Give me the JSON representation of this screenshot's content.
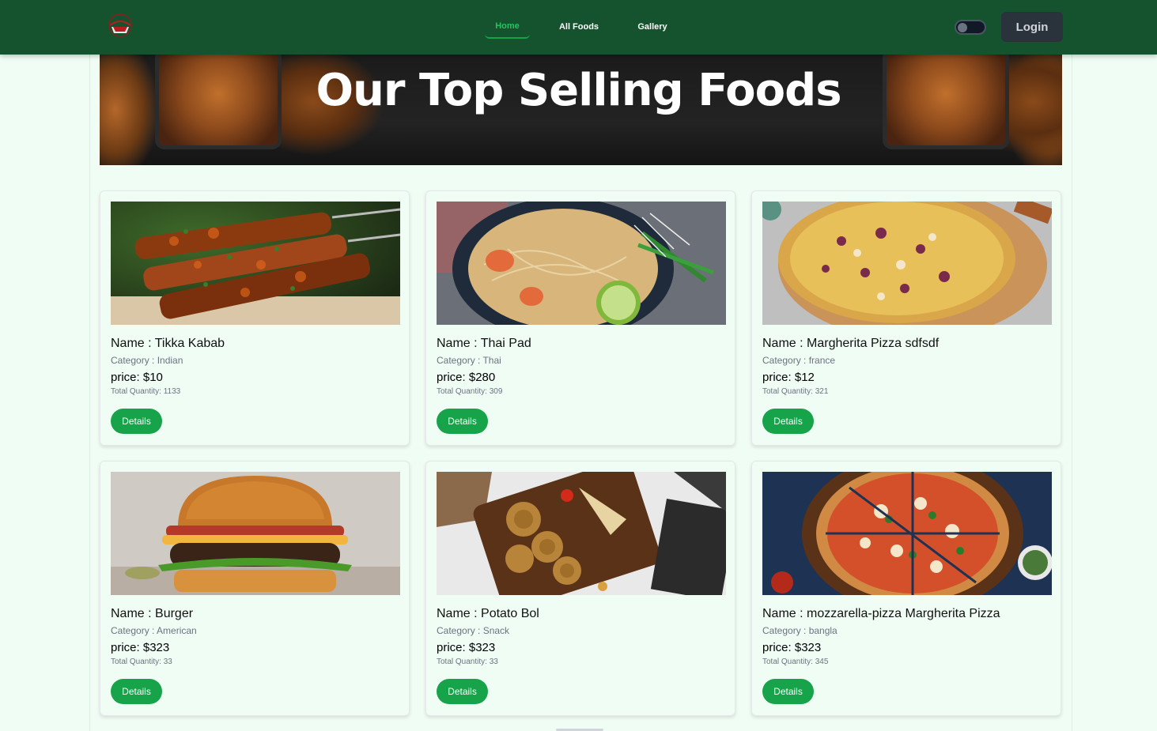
{
  "nav": {
    "links": [
      "Home",
      "All Foods",
      "Gallery"
    ],
    "login_label": "Login",
    "theme_toggle": "off"
  },
  "banner": {
    "title": "Our Top Selling Foods"
  },
  "colors": {
    "nav_bg": "#14532d",
    "accent": "#16a34a",
    "page_bg": "#f0fdf4",
    "login_bg": "#2a323c"
  },
  "foods": [
    {
      "name": "Name : Tikka Kabab",
      "category": "Category : Indian",
      "price": "price: $10",
      "quantity": "Total Quantity: 1133",
      "button": "Details",
      "image": "tikka-kabab-photo"
    },
    {
      "name": "Name : Thai Pad",
      "category": "Category : Thai",
      "price": "price: $280",
      "quantity": "Total Quantity: 309",
      "button": "Details",
      "image": "thai-pad-photo"
    },
    {
      "name": "Name : Margherita Pizza sdfsdf",
      "category": "Category : france",
      "price": "price: $12",
      "quantity": "Total Quantity: 321",
      "button": "Details",
      "image": "margherita-pizza-photo"
    },
    {
      "name": "Name : Burger",
      "category": "Category : American",
      "price": "price: $323",
      "quantity": "Total Quantity: 33",
      "button": "Details",
      "image": "burger-photo"
    },
    {
      "name": "Name : Potato Bol",
      "category": "Category : Snack",
      "price": "price: $323",
      "quantity": "Total Quantity: 33",
      "button": "Details",
      "image": "potato-bol-photo"
    },
    {
      "name": "Name : mozzarella-pizza Margherita Pizza",
      "category": "Category : bangla",
      "price": "price: $323",
      "quantity": "Total Quantity: 345",
      "button": "Details",
      "image": "mozzarella-pizza-photo"
    }
  ]
}
